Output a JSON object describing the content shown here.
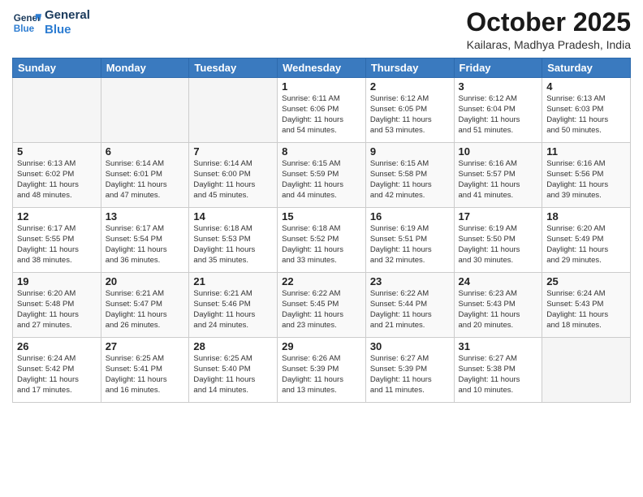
{
  "logo": {
    "line1": "General",
    "line2": "Blue"
  },
  "header": {
    "title": "October 2025",
    "subtitle": "Kailaras, Madhya Pradesh, India"
  },
  "weekdays": [
    "Sunday",
    "Monday",
    "Tuesday",
    "Wednesday",
    "Thursday",
    "Friday",
    "Saturday"
  ],
  "weeks": [
    [
      {
        "day": "",
        "info": ""
      },
      {
        "day": "",
        "info": ""
      },
      {
        "day": "",
        "info": ""
      },
      {
        "day": "1",
        "info": "Sunrise: 6:11 AM\nSunset: 6:06 PM\nDaylight: 11 hours\nand 54 minutes."
      },
      {
        "day": "2",
        "info": "Sunrise: 6:12 AM\nSunset: 6:05 PM\nDaylight: 11 hours\nand 53 minutes."
      },
      {
        "day": "3",
        "info": "Sunrise: 6:12 AM\nSunset: 6:04 PM\nDaylight: 11 hours\nand 51 minutes."
      },
      {
        "day": "4",
        "info": "Sunrise: 6:13 AM\nSunset: 6:03 PM\nDaylight: 11 hours\nand 50 minutes."
      }
    ],
    [
      {
        "day": "5",
        "info": "Sunrise: 6:13 AM\nSunset: 6:02 PM\nDaylight: 11 hours\nand 48 minutes."
      },
      {
        "day": "6",
        "info": "Sunrise: 6:14 AM\nSunset: 6:01 PM\nDaylight: 11 hours\nand 47 minutes."
      },
      {
        "day": "7",
        "info": "Sunrise: 6:14 AM\nSunset: 6:00 PM\nDaylight: 11 hours\nand 45 minutes."
      },
      {
        "day": "8",
        "info": "Sunrise: 6:15 AM\nSunset: 5:59 PM\nDaylight: 11 hours\nand 44 minutes."
      },
      {
        "day": "9",
        "info": "Sunrise: 6:15 AM\nSunset: 5:58 PM\nDaylight: 11 hours\nand 42 minutes."
      },
      {
        "day": "10",
        "info": "Sunrise: 6:16 AM\nSunset: 5:57 PM\nDaylight: 11 hours\nand 41 minutes."
      },
      {
        "day": "11",
        "info": "Sunrise: 6:16 AM\nSunset: 5:56 PM\nDaylight: 11 hours\nand 39 minutes."
      }
    ],
    [
      {
        "day": "12",
        "info": "Sunrise: 6:17 AM\nSunset: 5:55 PM\nDaylight: 11 hours\nand 38 minutes."
      },
      {
        "day": "13",
        "info": "Sunrise: 6:17 AM\nSunset: 5:54 PM\nDaylight: 11 hours\nand 36 minutes."
      },
      {
        "day": "14",
        "info": "Sunrise: 6:18 AM\nSunset: 5:53 PM\nDaylight: 11 hours\nand 35 minutes."
      },
      {
        "day": "15",
        "info": "Sunrise: 6:18 AM\nSunset: 5:52 PM\nDaylight: 11 hours\nand 33 minutes."
      },
      {
        "day": "16",
        "info": "Sunrise: 6:19 AM\nSunset: 5:51 PM\nDaylight: 11 hours\nand 32 minutes."
      },
      {
        "day": "17",
        "info": "Sunrise: 6:19 AM\nSunset: 5:50 PM\nDaylight: 11 hours\nand 30 minutes."
      },
      {
        "day": "18",
        "info": "Sunrise: 6:20 AM\nSunset: 5:49 PM\nDaylight: 11 hours\nand 29 minutes."
      }
    ],
    [
      {
        "day": "19",
        "info": "Sunrise: 6:20 AM\nSunset: 5:48 PM\nDaylight: 11 hours\nand 27 minutes."
      },
      {
        "day": "20",
        "info": "Sunrise: 6:21 AM\nSunset: 5:47 PM\nDaylight: 11 hours\nand 26 minutes."
      },
      {
        "day": "21",
        "info": "Sunrise: 6:21 AM\nSunset: 5:46 PM\nDaylight: 11 hours\nand 24 minutes."
      },
      {
        "day": "22",
        "info": "Sunrise: 6:22 AM\nSunset: 5:45 PM\nDaylight: 11 hours\nand 23 minutes."
      },
      {
        "day": "23",
        "info": "Sunrise: 6:22 AM\nSunset: 5:44 PM\nDaylight: 11 hours\nand 21 minutes."
      },
      {
        "day": "24",
        "info": "Sunrise: 6:23 AM\nSunset: 5:43 PM\nDaylight: 11 hours\nand 20 minutes."
      },
      {
        "day": "25",
        "info": "Sunrise: 6:24 AM\nSunset: 5:43 PM\nDaylight: 11 hours\nand 18 minutes."
      }
    ],
    [
      {
        "day": "26",
        "info": "Sunrise: 6:24 AM\nSunset: 5:42 PM\nDaylight: 11 hours\nand 17 minutes."
      },
      {
        "day": "27",
        "info": "Sunrise: 6:25 AM\nSunset: 5:41 PM\nDaylight: 11 hours\nand 16 minutes."
      },
      {
        "day": "28",
        "info": "Sunrise: 6:25 AM\nSunset: 5:40 PM\nDaylight: 11 hours\nand 14 minutes."
      },
      {
        "day": "29",
        "info": "Sunrise: 6:26 AM\nSunset: 5:39 PM\nDaylight: 11 hours\nand 13 minutes."
      },
      {
        "day": "30",
        "info": "Sunrise: 6:27 AM\nSunset: 5:39 PM\nDaylight: 11 hours\nand 11 minutes."
      },
      {
        "day": "31",
        "info": "Sunrise: 6:27 AM\nSunset: 5:38 PM\nDaylight: 11 hours\nand 10 minutes."
      },
      {
        "day": "",
        "info": ""
      }
    ]
  ]
}
